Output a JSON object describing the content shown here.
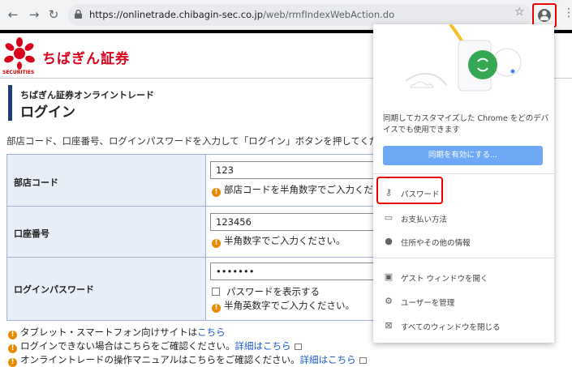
{
  "browser": {
    "url_host": "https://onlinetrade.chibagin-sec.co.jp",
    "url_path": "/web/rmfIndexWebAction.do"
  },
  "header": {
    "brand": "ちばぎん証券",
    "logo_sub": "SECURITIES"
  },
  "page": {
    "title_sub": "ちばぎん証券オンライントレード",
    "title_main": "ログイン",
    "intro": "部店コード、口座番号、ログインパスワードを入力して「ログイン」ボタンを押してください"
  },
  "form": {
    "branch": {
      "label": "部店コード",
      "value": "123",
      "hint": "部店コードを半角数字でご入力くださ"
    },
    "account": {
      "label": "口座番号",
      "value": "123456",
      "hint": "半角数字でご入力ください。"
    },
    "password": {
      "label": "ログインパスワード",
      "value": "•••••••",
      "show_label": "パスワードを表示する",
      "hint": "半角英数字でご入力ください。"
    }
  },
  "notes": [
    {
      "text": "タブレット・スマートフォン向けサイトは",
      "link": "こちら"
    },
    {
      "text": "ログインできない場合はこちらをご確認ください。",
      "link": "詳細はこちら"
    },
    {
      "text": "オンライントレードの操作マニュアルはこちらをご確認ください。",
      "link": "詳細はこちら"
    }
  ],
  "popup": {
    "sync_text": "同期してカスタマイズした Chrome をどのデバイスでも使用できます",
    "sync_button": "同期を有効にする...",
    "items": [
      {
        "icon": "key-icon",
        "label": "パスワード"
      },
      {
        "icon": "credit-card-icon",
        "label": "お支払い方法"
      },
      {
        "icon": "location-pin-icon",
        "label": "住所やその他の情報"
      },
      {
        "icon": "guest-window-icon",
        "label": "ゲスト ウィンドウを開く"
      },
      {
        "icon": "gear-icon",
        "label": "ユーザーを管理"
      },
      {
        "icon": "close-windows-icon",
        "label": "すべてのウィンドウを閉じる"
      }
    ]
  },
  "colors": {
    "brand": "#d9001b",
    "accent": "#1c3f78",
    "sync_button": "#6fa8f5",
    "highlight": "#ee0000"
  }
}
